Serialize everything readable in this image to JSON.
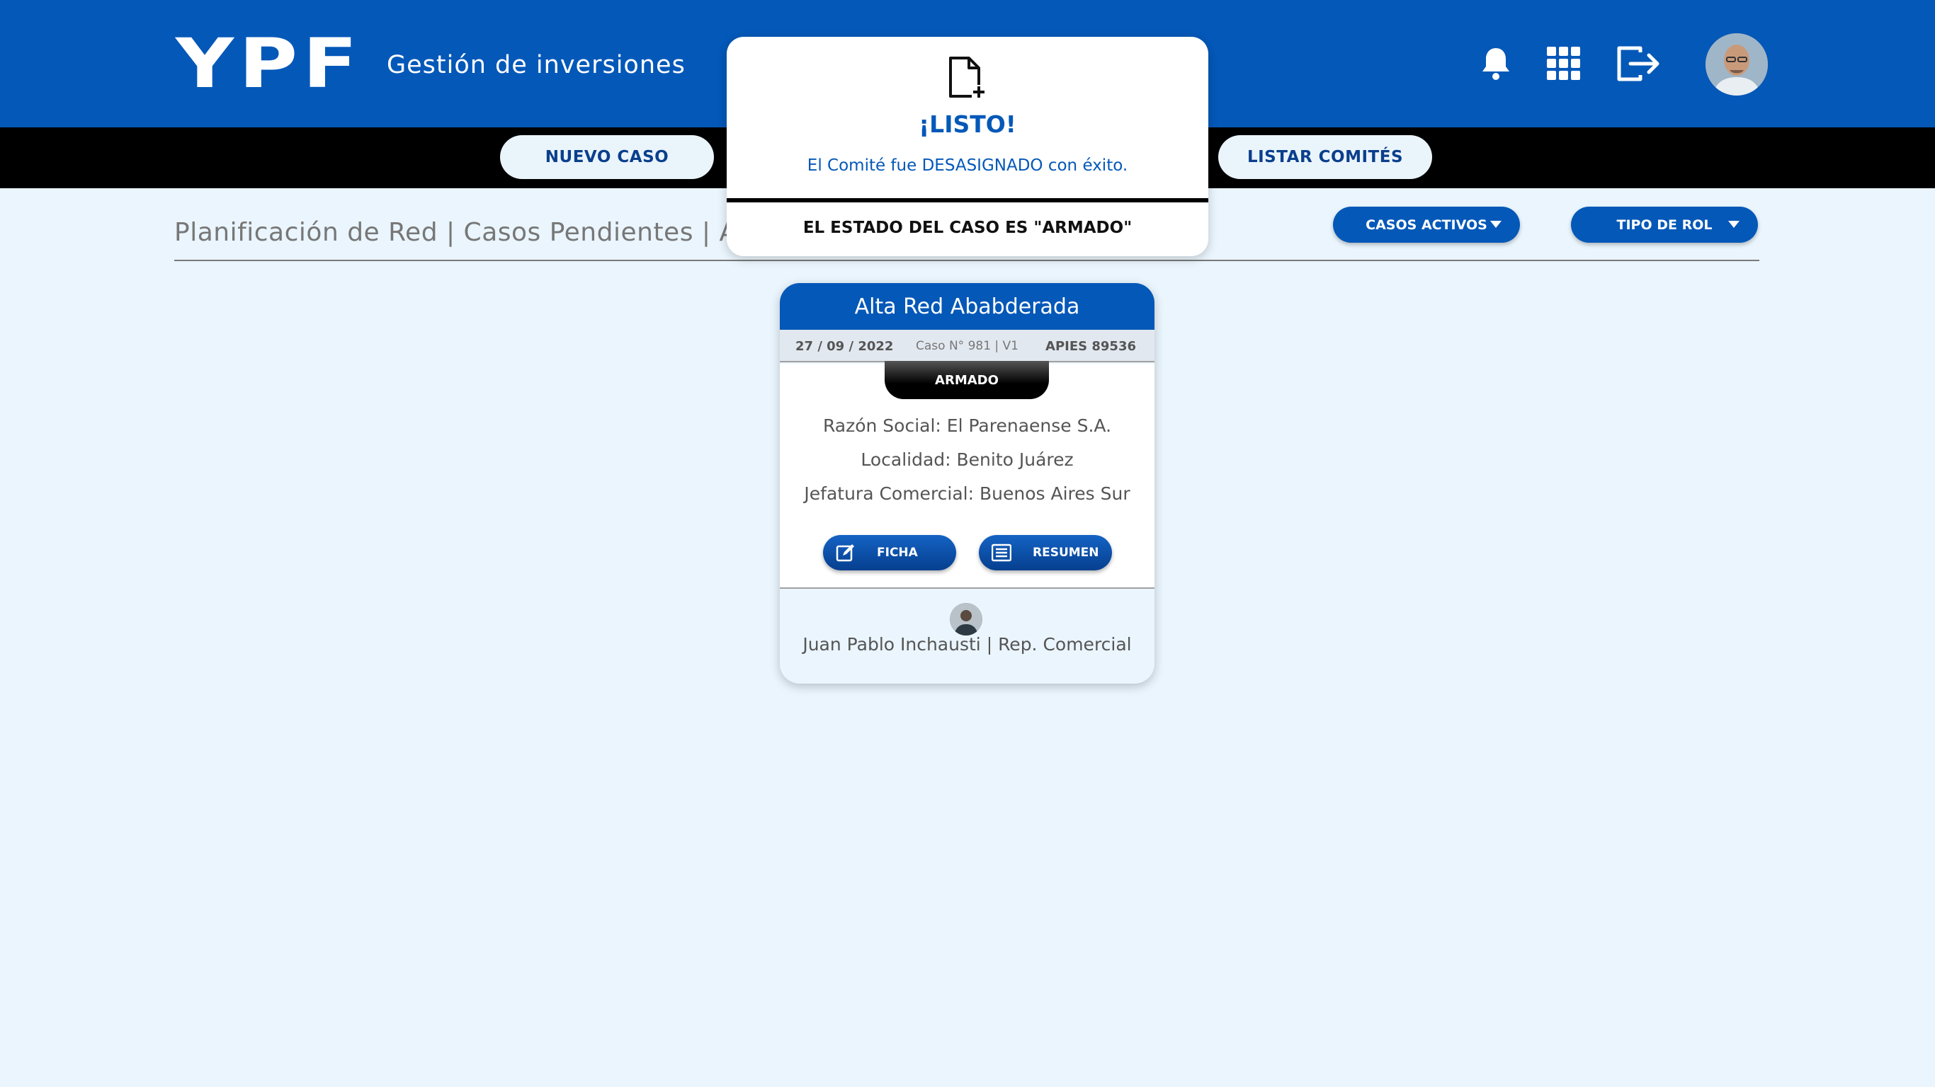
{
  "header": {
    "logo": "YPF",
    "app_title": "Gestión de inversiones",
    "icons": [
      "bell-icon",
      "apps-grid-icon",
      "logout-icon",
      "user-avatar"
    ]
  },
  "nav": {
    "nuevo_caso": "NUEVO CASO",
    "listar_comites": "LISTAR COMITÉS"
  },
  "breadcrumb": "Planificación de Red | Casos Pendientes | Armado",
  "filters": {
    "casos_activos": "CASOS ACTIVOS",
    "tipo_de_rol": "TIPO DE ROL"
  },
  "card": {
    "title": "Alta Red Ababderada",
    "date": "27 / 09 / 2022",
    "caso": "Caso N° 981 | V1",
    "apies": "APIES 89536",
    "status": "ARMADO",
    "razon_social": "Razón Social: El Parenaense S.A.",
    "localidad": "Localidad: Benito Juárez",
    "jefatura": "Jefatura Comercial: Buenos Aires Sur",
    "ficha_label": "FICHA",
    "resumen_label": "RESUMEN",
    "user": "Juan Pablo Inchausti | Rep. Comercial"
  },
  "modal": {
    "icon": "file-add-icon",
    "title": "¡LISTO!",
    "message": "El Comité fue DESASIGNADO con éxito.",
    "state": "EL ESTADO DEL CASO ES \"ARMADO\""
  },
  "colors": {
    "brand_blue": "#0458b8",
    "nav_black": "#000000",
    "page_bg": "#eaf5fd"
  }
}
